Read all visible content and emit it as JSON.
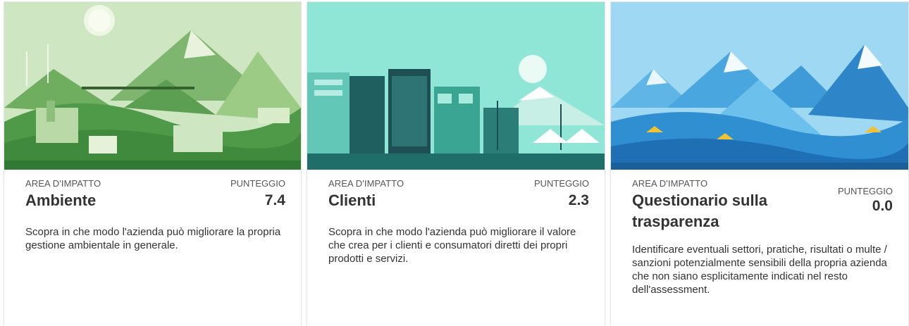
{
  "cards": [
    {
      "area_label": "AREA D'IMPATTO",
      "score_label": "PUNTEGGIO",
      "title": "Ambiente",
      "score": "7.4",
      "description": "Scopra in che modo l'azienda può migliorare la propria gestione ambientale in generale.",
      "image": "green-landscape-illustration",
      "accent": "#5fa85a"
    },
    {
      "area_label": "AREA D'IMPATTO",
      "score_label": "PUNTEGGIO",
      "title": "Clienti",
      "score": "2.3",
      "description": "Scopra in che modo l'azienda può migliorare il valore che crea per i clienti e consumatori diretti dei propri prodotti e servizi.",
      "image": "teal-city-illustration",
      "accent": "#2aa899"
    },
    {
      "area_label": "AREA D'IMPATTO",
      "score_label": "PUNTEGGIO",
      "title": "Questionario sulla trasparenza",
      "score": "0.0",
      "description": "Identificare eventuali settori, pratiche, risultati o multe / sanzioni potenzialmente sensibili della propria azienda che non siano esplicitamente indicati nel resto dell'assessment.",
      "image": "blue-mountains-illustration",
      "accent": "#2b8fd0"
    }
  ]
}
